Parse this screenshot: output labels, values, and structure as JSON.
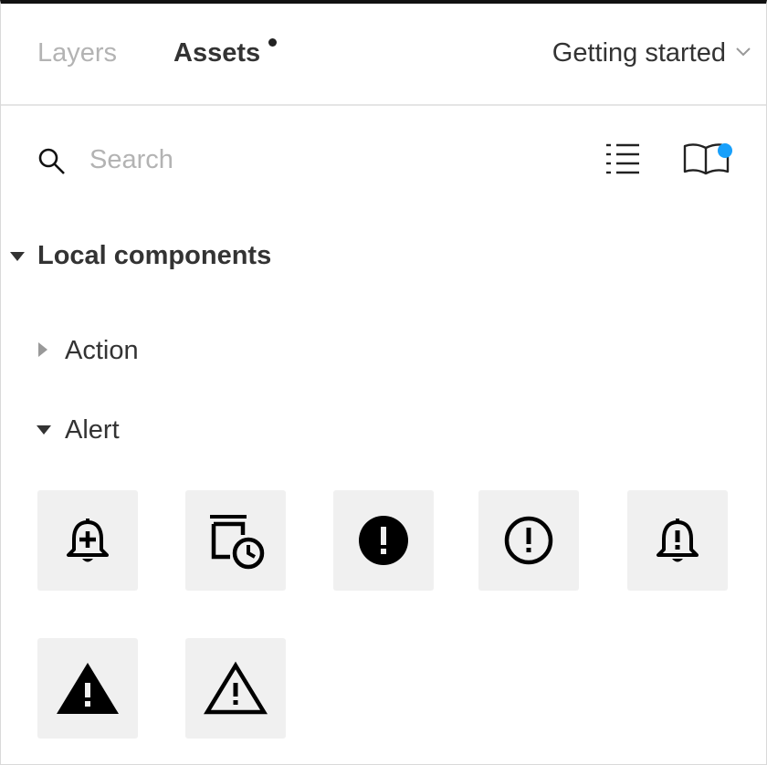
{
  "header": {
    "tabs": [
      {
        "label": "Layers",
        "active": false
      },
      {
        "label": "Assets",
        "active": true,
        "has_notification": true
      }
    ],
    "page_select": "Getting started"
  },
  "search": {
    "placeholder": "Search",
    "value": ""
  },
  "toolbar": {
    "list_view_icon": "list-icon",
    "library_icon": "book-open-icon",
    "library_badge_color": "#18a0fb"
  },
  "assets": {
    "section_label": "Local components",
    "groups": [
      {
        "label": "Action",
        "expanded": false
      },
      {
        "label": "Alert",
        "expanded": true,
        "components": [
          "bell-plus-icon",
          "delete-clock-icon",
          "error-filled-icon",
          "error-outline-icon",
          "bell-alert-icon",
          "warning-filled-icon",
          "warning-outline-icon"
        ]
      }
    ]
  },
  "colors": {
    "accent": "#18a0fb",
    "tile_bg": "#f0f0f0",
    "text": "#333333",
    "muted": "#b3b3b3"
  }
}
